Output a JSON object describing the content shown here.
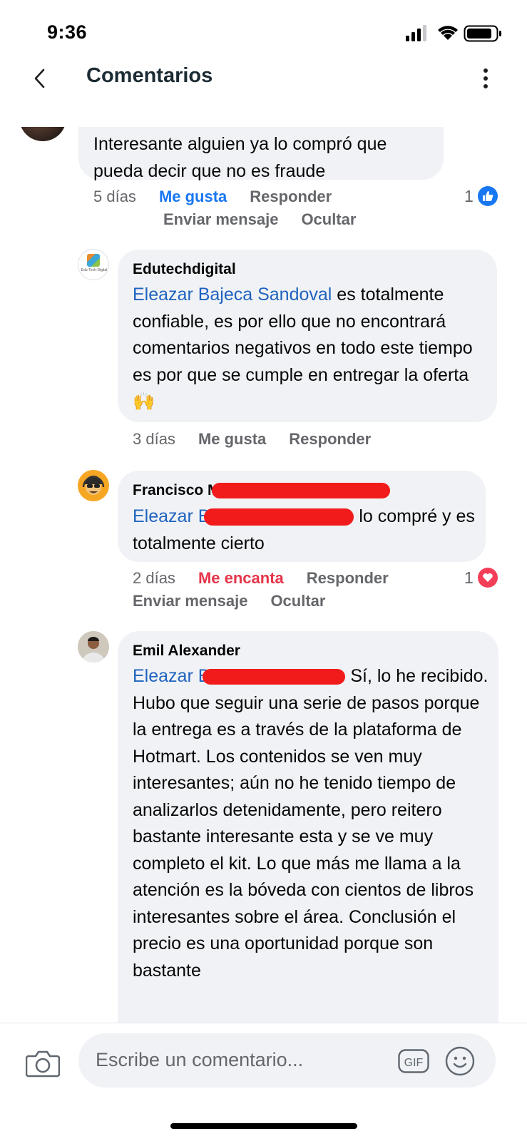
{
  "status_bar": {
    "time": "9:36"
  },
  "header": {
    "title": "Comentarios"
  },
  "comments": [
    {
      "text": "Interesante alguien ya lo compró que pueda decir que no es fraude",
      "time": "5 días",
      "like_label": "Me gusta",
      "reply_label": "Responder",
      "message_label": "Enviar mensaje",
      "hide_label": "Ocultar",
      "reaction_count": "1"
    },
    {
      "author": "Edutechdigital",
      "avatar_caption": "Edu-Tech-Digital",
      "mention": "Eleazar Bajeca Sandoval",
      "text": " es totalmente confiable, es por ello que no encontrará comentarios negativos en todo este tiempo es por que se cumple en entregar la oferta 🙌",
      "time": "3 días",
      "like_label": "Me gusta",
      "reply_label": "Responder"
    },
    {
      "author": "Francisco M",
      "mention": "Eleazar B",
      "text": " lo compré y es totalmente cierto",
      "time": "2 días",
      "like_label": "Me encanta",
      "reply_label": "Responder",
      "message_label": "Enviar mensaje",
      "hide_label": "Ocultar",
      "reaction_count": "1"
    },
    {
      "author": "Emil Alexander",
      "mention": "Eleazar B",
      "text": " Sí, lo he recibido. Hubo que seguir una serie de pasos porque la entrega es a través de la plataforma de Hotmart. Los contenidos se ven muy interesantes; aún no he tenido tiempo de analizarlos detenidamente, pero reitero bastante interesante esta y se ve muy completo el kit. Lo que más me llama a la atención es la bóveda con cientos de libros interesantes sobre el área. Conclusión el precio es una oportunidad porque son bastante"
    }
  ],
  "composer": {
    "placeholder": "Escribe un comentario...",
    "gif_label": "GIF"
  },
  "colors": {
    "mention": "#1f63bf",
    "like": "#1877f2",
    "love": "#e5354a",
    "bubble": "#f0f2f5",
    "redaction": "#f21b1b"
  }
}
